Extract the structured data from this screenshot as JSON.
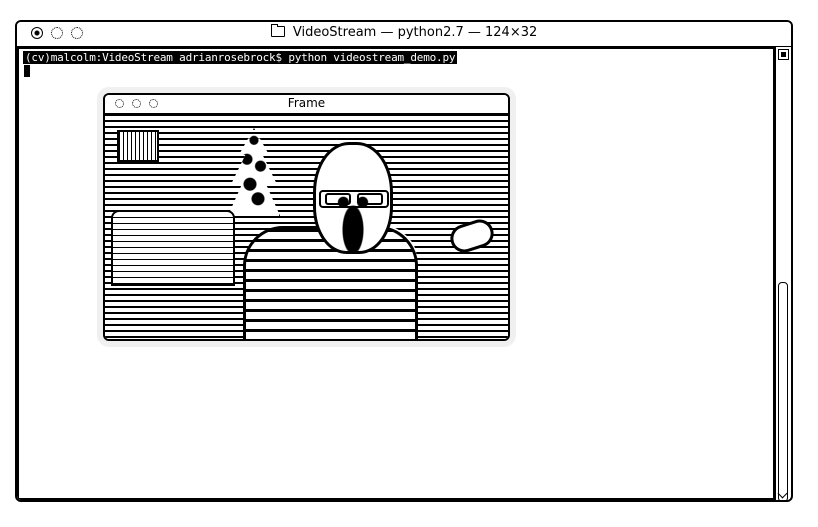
{
  "terminal": {
    "title": "VideoStream — python2.7 — 124×32",
    "prompt": "(cv)malcolm:VideoStream adrianrosebrock$ python videostream_demo.py"
  },
  "frame": {
    "title": "Frame"
  },
  "icons": {
    "terminal_close": "close-icon",
    "terminal_minimize": "minimize-icon",
    "terminal_zoom": "zoom-icon",
    "folder": "folder-icon",
    "frame_close": "close-icon",
    "frame_minimize": "minimize-icon",
    "frame_zoom": "zoom-icon",
    "scroll_top": "scroll-top-icon",
    "scroll_bottom": "chevron-down-icon"
  },
  "colors": {
    "foreground": "#000000",
    "background": "#ffffff"
  }
}
